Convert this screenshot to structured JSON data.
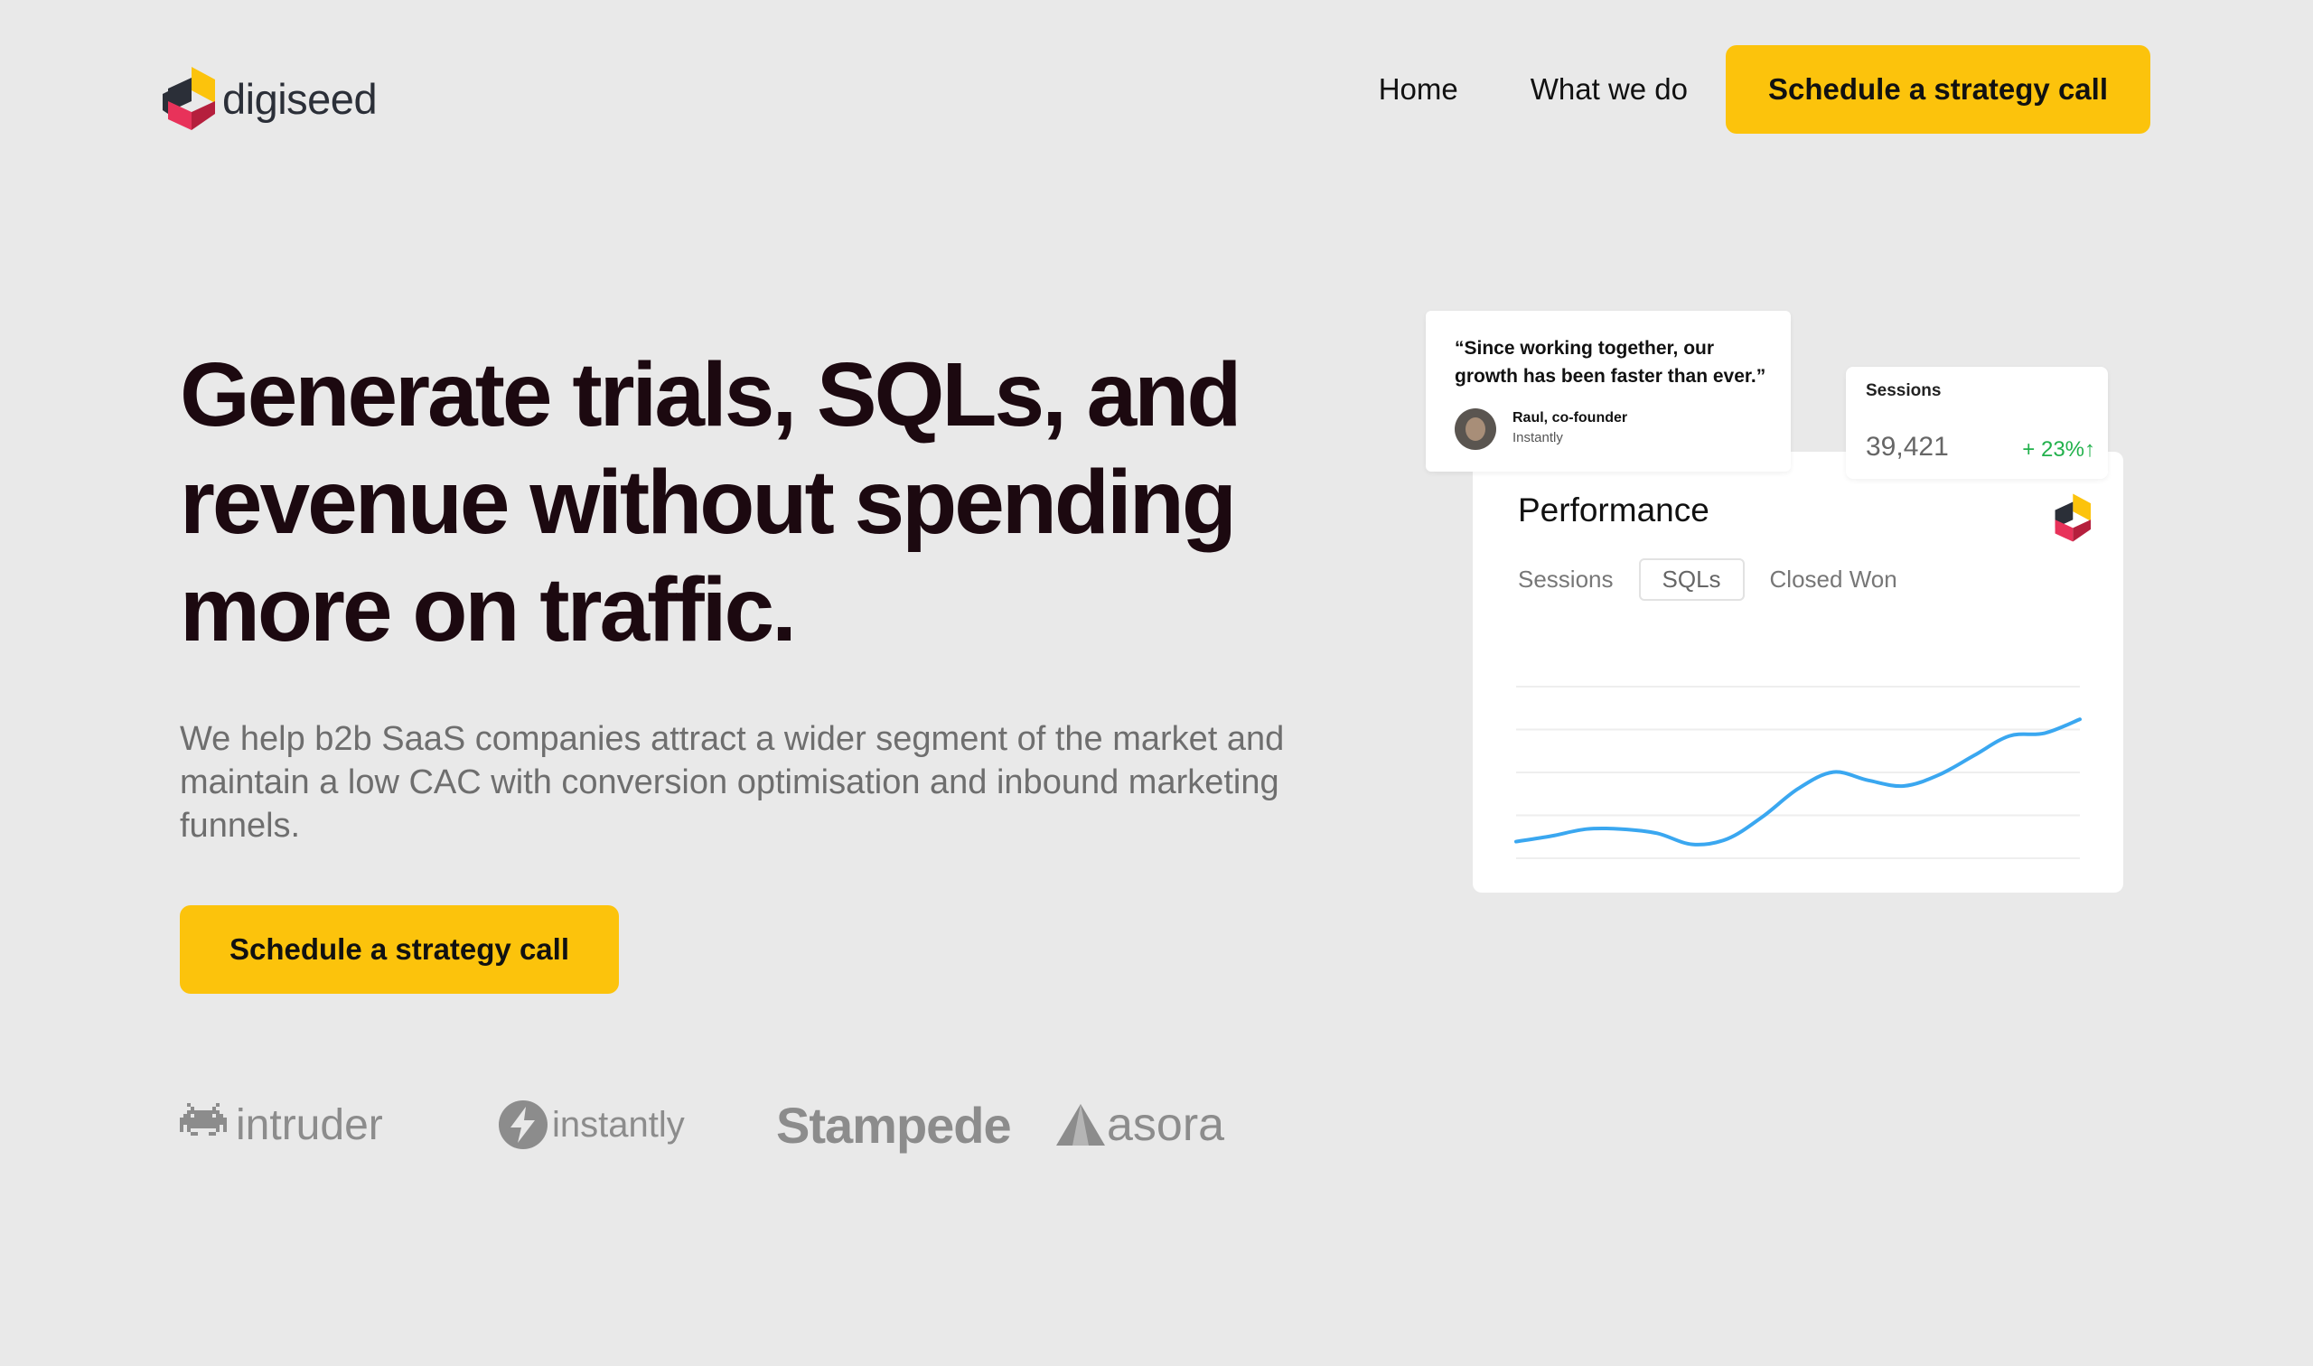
{
  "header": {
    "logo_text": "digiseed",
    "nav": [
      {
        "label": "Home"
      },
      {
        "label": "What we do"
      }
    ],
    "cta_label": "Schedule a strategy call"
  },
  "hero": {
    "headline": "Generate trials, SQLs, and revenue without spending more on traffic.",
    "subtext": "We help b2b SaaS companies attract a wider segment of the market and maintain a low CAC with conversion optimisation and inbound marketing funnels.",
    "cta_label": "Schedule a strategy call"
  },
  "brands": [
    {
      "name": "intruder",
      "icon": "space-invader-icon"
    },
    {
      "name": "instantly",
      "icon": "lightning-icon"
    },
    {
      "name": "Stampede",
      "icon": ""
    },
    {
      "name": "asora",
      "icon": "triangle-a-icon"
    }
  ],
  "testimonial": {
    "quote": "“Since working together, our growth has been faster than ever.”",
    "author": "Raul, co-founder",
    "company": "Instantly"
  },
  "sessions_card": {
    "label": "Sessions",
    "value": "39,421",
    "delta": "+ 23%↑"
  },
  "performance": {
    "title": "Performance",
    "tabs": [
      {
        "label": "Sessions",
        "active": false
      },
      {
        "label": "SQLs",
        "active": true
      },
      {
        "label": "Closed Won",
        "active": false
      }
    ]
  },
  "chart_data": {
    "type": "line",
    "series": [
      {
        "values": [
          12,
          16,
          21,
          21,
          18,
          10,
          14,
          30,
          50,
          62,
          56,
          52,
          60,
          74,
          88,
          90,
          100
        ]
      }
    ],
    "ylim": [
      0,
      130
    ],
    "grid": true,
    "line_color": "#3aa7f0"
  },
  "colors": {
    "accent": "#fcc30c",
    "background": "#e9e9e9",
    "positive": "#22b14c"
  }
}
